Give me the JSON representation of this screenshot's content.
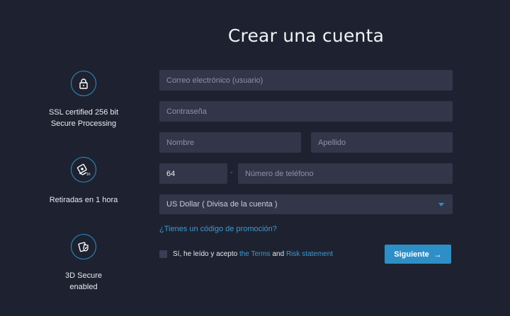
{
  "title": "Crear una cuenta",
  "features": [
    {
      "icon": "lock-icon",
      "caption_line1": "SSL certified 256 bit",
      "caption_line2": "Secure Processing"
    },
    {
      "icon": "cash-withdrawal-icon",
      "caption_line1": "Retiradas en 1 hora",
      "caption_line2": ""
    },
    {
      "icon": "secure-card-icon",
      "caption_line1": "3D Secure",
      "caption_line2": "enabled"
    }
  ],
  "form": {
    "email_placeholder": "Correo electrónico (usuario)",
    "password_placeholder": "Contraseña",
    "first_name_placeholder": "Nombre",
    "last_name_placeholder": "Apellido",
    "phone_prefix_value": "64",
    "phone_separator": "-",
    "phone_placeholder": "Número de teléfono",
    "currency_selected": "US Dollar ( Divisa de la cuenta )",
    "promo_link": "¿Tienes un código de promoción?",
    "agree_text": "Sí, he leído y acepto",
    "terms_link": "the Terms",
    "and_text": "and",
    "risk_link": "Risk statement",
    "next_label": "Siguiente",
    "next_arrow": "→"
  },
  "colors": {
    "background": "#1e2230",
    "field": "#323649",
    "accent": "#2e8fc6",
    "link": "#3a9bd5"
  }
}
